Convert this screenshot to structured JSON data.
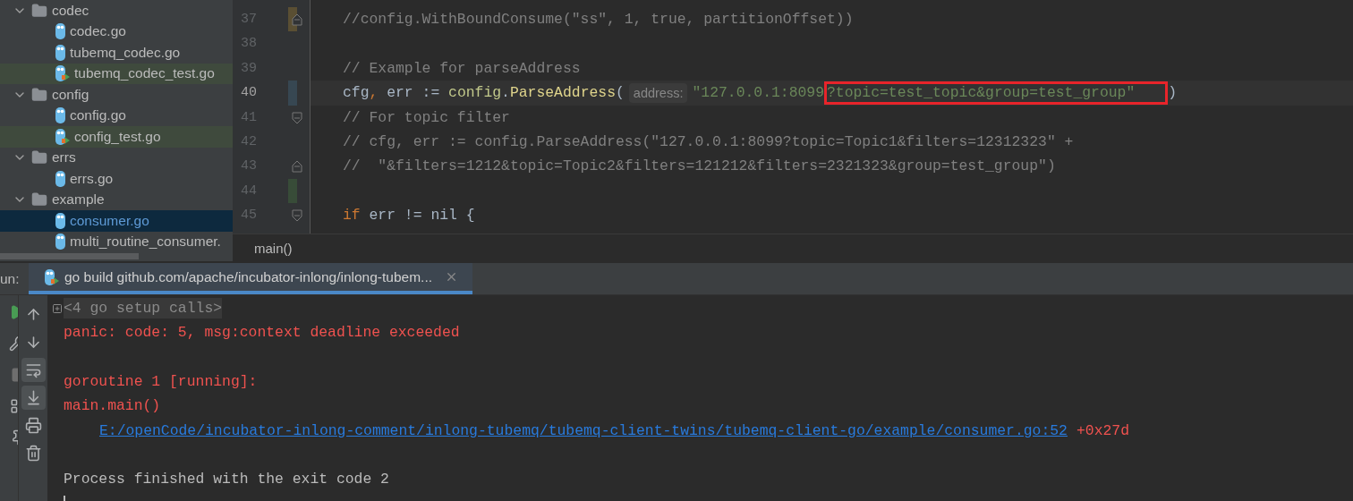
{
  "project_tree": {
    "items": [
      {
        "name": "codec",
        "kind": "folder",
        "expanded": true,
        "children": [
          {
            "name": "codec.go",
            "kind": "file",
            "selected": false
          },
          {
            "name": "tubemq_codec.go",
            "kind": "file",
            "selected": false
          },
          {
            "name": "tubemq_codec_test.go",
            "kind": "test",
            "selected": false
          }
        ]
      },
      {
        "name": "config",
        "kind": "folder",
        "expanded": true,
        "children": [
          {
            "name": "config.go",
            "kind": "file",
            "selected": false
          },
          {
            "name": "config_test.go",
            "kind": "test",
            "selected": false
          }
        ]
      },
      {
        "name": "errs",
        "kind": "folder",
        "expanded": true,
        "children": [
          {
            "name": "errs.go",
            "kind": "file",
            "selected": false
          }
        ]
      },
      {
        "name": "example",
        "kind": "folder",
        "expanded": true,
        "children": [
          {
            "name": "consumer.go",
            "kind": "file",
            "selected": true
          },
          {
            "name": "multi_routine_consumer.",
            "kind": "file",
            "selected": false
          }
        ]
      }
    ]
  },
  "editor": {
    "lines": [
      {
        "number": "37",
        "current": false,
        "color": "#5a4f33",
        "fold_start": false,
        "fold_end": true,
        "tokens": [
          {
            "text": "//config.WithBoundConsume(\"ss\", 1, true, partitionOffset))",
            "kind": "comment"
          }
        ]
      },
      {
        "number": "38",
        "current": false,
        "fold_start": false,
        "fold_end": false
      },
      {
        "number": "39",
        "current": false,
        "fold_start": false,
        "fold_end": false,
        "tokens": [
          {
            "text": "// Example for parseAddress",
            "kind": "comment"
          }
        ]
      },
      {
        "number": "40",
        "current": true,
        "color": "#374752",
        "fold_start": false,
        "fold_end": false,
        "tokens": [
          {
            "text": "cfg",
            "kind": "plain"
          },
          {
            "text": ",",
            "kind": "punct"
          },
          {
            "text": " err := ",
            "kind": "plain"
          },
          {
            "text": "config",
            "kind": "pkg"
          },
          {
            "text": ".",
            "kind": "plain"
          },
          {
            "text": "ParseAddress",
            "kind": "func"
          },
          {
            "text": "(",
            "kind": "plain"
          },
          {
            "text": "address:",
            "kind": "hint"
          },
          {
            "text": "\"127.0.0.1:8099",
            "kind": "string"
          },
          {
            "text": "?topic=test_topic&group=test_group\"",
            "kind": "string",
            "boxed": true
          },
          {
            "text": ")",
            "kind": "plain"
          }
        ]
      },
      {
        "number": "41",
        "current": false,
        "fold_start": true,
        "fold_end": false,
        "tokens": [
          {
            "text": "// For topic filter",
            "kind": "comment"
          }
        ]
      },
      {
        "number": "42",
        "current": false,
        "fold_start": false,
        "fold_end": false,
        "tokens": [
          {
            "text": "// cfg, err := config.ParseAddress(\"127.0.0.1:8099?topic=Topic1&filters=12312323\" +",
            "kind": "comment"
          }
        ]
      },
      {
        "number": "43",
        "current": false,
        "fold_start": false,
        "fold_end": true,
        "tokens": [
          {
            "text": "//  \"&filters=1212&topic=Topic2&filters=121212&filters=2321323&group=test_group\")",
            "kind": "comment"
          }
        ]
      },
      {
        "number": "44",
        "current": false,
        "color": "#384c38",
        "fold_start": false,
        "fold_end": false
      },
      {
        "number": "45",
        "current": false,
        "fold_start": true,
        "fold_end": false,
        "tokens": [
          {
            "text": "if",
            "kind": "keyword"
          },
          {
            "text": " err != nil {",
            "kind": "plain"
          }
        ]
      }
    ]
  },
  "breadcrumb": "main()",
  "run_panel": {
    "label": "un:",
    "tabs": [
      {
        "title": "go build github.com/apache/incubator-inlong/inlong-tubem...",
        "selected": true
      }
    ],
    "toolbar": [
      {
        "kind": "up",
        "on": false
      },
      {
        "kind": "down",
        "on": false
      },
      {
        "kind": "wrap",
        "on": true
      },
      {
        "kind": "scroll",
        "on": true
      },
      {
        "kind": "print",
        "on": false
      },
      {
        "kind": "trash",
        "on": false
      }
    ],
    "console": [
      {
        "kind": "setup",
        "text": "<4 go setup calls>"
      },
      {
        "kind": "error",
        "text": "panic: code: 5, msg:context deadline exceeded"
      },
      {
        "kind": "blank"
      },
      {
        "kind": "error",
        "text": "goroutine 1 [running]:"
      },
      {
        "kind": "error",
        "text": "main.main()"
      },
      {
        "kind": "link",
        "text": "E:/openCode/incubator-inlong-comment/inlong-tubemq/tubemq-client-twins/tubemq-client-go/example/consumer.go:52",
        "suffix": "+0x27d"
      },
      {
        "kind": "blank"
      },
      {
        "kind": "normal",
        "text": "Process finished with the exit code 2"
      },
      {
        "kind": "cursor"
      }
    ]
  }
}
